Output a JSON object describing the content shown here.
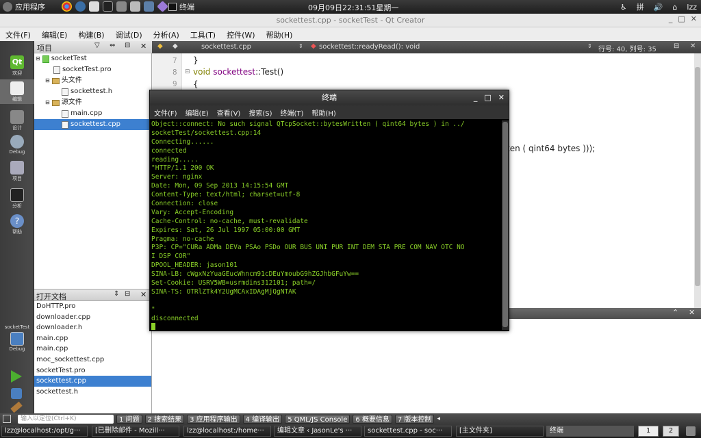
{
  "top_panel": {
    "app_menu": "应用程序",
    "terminal_task": "终端",
    "clock": "09月09日22:31:51星期一",
    "input_method": "拼",
    "user": "lzz"
  },
  "window": {
    "title": "sockettest.cpp - socketTest - Qt Creator"
  },
  "menubar": [
    "文件(F)",
    "编辑(E)",
    "构建(B)",
    "调试(D)",
    "分析(A)",
    "工具(T)",
    "控件(W)",
    "帮助(H)"
  ],
  "modes": [
    {
      "label": "欢迎"
    },
    {
      "label": "编辑"
    },
    {
      "label": "设计"
    },
    {
      "label": "Debug"
    },
    {
      "label": "项目"
    },
    {
      "label": "分析"
    },
    {
      "label": "帮助"
    }
  ],
  "target": {
    "project": "socketTest",
    "label": "Debug"
  },
  "project_panel": {
    "title": "项目",
    "tree": [
      {
        "label": "socketTest",
        "level": 0,
        "kind": "project"
      },
      {
        "label": "socketTest.pro",
        "level": 1,
        "kind": "file"
      },
      {
        "label": "头文件",
        "level": 1,
        "kind": "folder"
      },
      {
        "label": "sockettest.h",
        "level": 2,
        "kind": "file"
      },
      {
        "label": "源文件",
        "level": 1,
        "kind": "folder"
      },
      {
        "label": "main.cpp",
        "level": 2,
        "kind": "file"
      },
      {
        "label": "sockettest.cpp",
        "level": 2,
        "kind": "file",
        "selected": true
      }
    ]
  },
  "open_docs": {
    "title": "打开文档",
    "items": [
      {
        "label": "DoHTTP.pro"
      },
      {
        "label": "downloader.cpp"
      },
      {
        "label": "downloader.h"
      },
      {
        "label": "main.cpp"
      },
      {
        "label": "main.cpp"
      },
      {
        "label": "moc_sockettest.cpp"
      },
      {
        "label": "socketTest.pro"
      },
      {
        "label": "sockettest.cpp",
        "selected": true
      },
      {
        "label": "sockettest.h"
      }
    ]
  },
  "editor": {
    "file": "sockettest.cpp",
    "symbol": "sockettest::readyRead(): void",
    "position": "行号: 40, 列号: 35",
    "line_numbers": [
      "7",
      "8",
      "9"
    ],
    "code_line_1": "}",
    "code_void": "void",
    "code_class": "sockettest",
    "code_func": "::Test()",
    "code_brace": "{",
    "code_tail_a": "ten ( ",
    "code_tail_b": "qint64",
    "code_tail_c": " bytes )));"
  },
  "terminal": {
    "title": "终端",
    "menu": [
      "文件(F)",
      "编辑(E)",
      "查看(V)",
      "搜索(S)",
      "终端(T)",
      "帮助(H)"
    ],
    "lines": [
      "Object::connect: No such signal QTcpSocket::bytesWritten ( qint64 bytes ) in ../",
      "socketTest/sockettest.cpp:14",
      "Connecting......",
      "connected",
      "reading.....",
      "\"HTTP/1.1 200 OK",
      "Server: nginx",
      "Date: Mon, 09 Sep 2013 14:15:54 GMT",
      "Content-Type: text/html; charset=utf-8",
      "Connection: close",
      "Vary: Accept-Encoding",
      "Cache-Control: no-cache, must-revalidate",
      "Expires: Sat, 26 Jul 1997 05:00:00 GMT",
      "Pragma: no-cache",
      "P3P: CP=\"CURa ADMa DEVa PSAo PSDo OUR BUS UNI PUR INT DEM STA PRE COM NAV OTC NO",
      "I DSP COR\"",
      "DPOOL_HEADER: jason101",
      "SINA-LB: cWgxNzYuaGEucWhncm91cDEuYmoubG9hZGJhbGFuYw==",
      "Set-Cookie: USRV5WB=usrmdins312101; path=/",
      "SINA-TS: OTRlZTk4Y2UgMCAxIDAgMjQgNTAK",
      "",
      "\"",
      "disconnected"
    ]
  },
  "statusbar": {
    "search_placeholder": "输入以定位(Ctrl+K)",
    "tabs": [
      "1 问题",
      "2 搜索结果",
      "3 应用程序输出",
      "4 编译输出",
      "5 QML/JS Console",
      "6 概要信息",
      "7 版本控制"
    ]
  },
  "taskbar": {
    "tasks": [
      "lzz@localhost:/opt/g···",
      "[已删除邮件 - Mozill···",
      "lzz@localhost:/home···",
      "编辑文章 ‹ JasonLe's ···",
      "sockettest.cpp - soc···",
      "[主文件夹]",
      "终端"
    ],
    "workspaces": [
      "1",
      "2"
    ]
  },
  "colors": {
    "terminal_text": "#8ad028",
    "selection": "#3d80d0"
  }
}
